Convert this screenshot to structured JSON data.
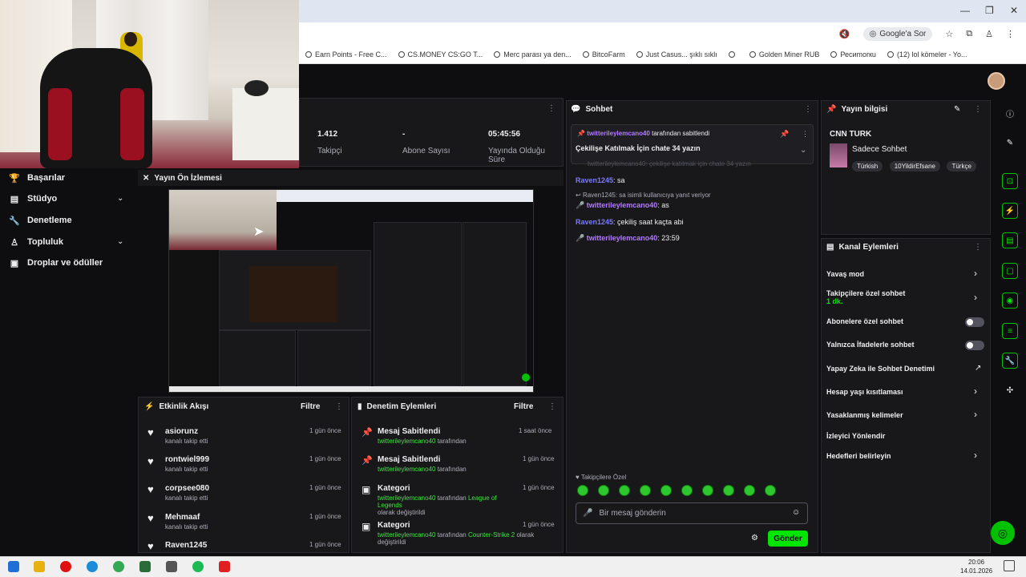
{
  "browser": {
    "google_sor": "Google'a Sor",
    "bookmarks": [
      "Earn Points - Free C...",
      "CS.MONEY CS:GO T...",
      "Merc parası ya den...",
      "BitcoFarm",
      "Just Casus... şıklı sıklı",
      "",
      "Golden Miner RUB",
      "Ресиmоrкu",
      "(12) lol kömeler - Yo..."
    ]
  },
  "stats": {
    "followers_value": "1.412",
    "followers_label": "Takipçi",
    "subs_value": "-",
    "subs_label": "Abone Sayısı",
    "live_value": "05:45:56",
    "live_label": "Yayında Olduğu Süre"
  },
  "nav": {
    "items": [
      {
        "label": "Başarılar"
      },
      {
        "label": "Stüdyo"
      },
      {
        "label": "Denetleme"
      },
      {
        "label": "Topluluk"
      },
      {
        "label": "Droplar ve ödüller"
      }
    ]
  },
  "preview": {
    "title": "Yayın Ön İzlemesi"
  },
  "activity": {
    "title": "Etkinlik Akışı",
    "filter": "Filtre",
    "rows": [
      {
        "name": "asiorunz",
        "sub": "kanalı takip etti",
        "time": "1 gün önce"
      },
      {
        "name": "rontwiel999",
        "sub": "kanalı takip etti",
        "time": "1 gün önce"
      },
      {
        "name": "corpsee080",
        "sub": "kanalı takip etti",
        "time": "1 gün önce"
      },
      {
        "name": "Mehmaaf",
        "sub": "kanalı takip etti",
        "time": "1 gün önce"
      },
      {
        "name": "Raven1245",
        "sub": "",
        "time": "1 gün önce"
      }
    ]
  },
  "modactions": {
    "title": "Denetim Eylemleri",
    "filter": "Filtre",
    "rows": [
      {
        "title": "Mesaj Sabitlendi",
        "user": "twitterileylemcano40",
        "rest": " tarafından",
        "extra": "",
        "time": "1 saat önce"
      },
      {
        "title": "Mesaj Sabitlendi",
        "user": "twitterileylemcano40",
        "rest": " tarafından",
        "extra": "",
        "time": "1 gün önce"
      },
      {
        "title": "Kategori",
        "user": "twitterileylemcano40",
        "rest": " tarafından ",
        "hl": "League of Legends",
        "extra": "olarak değiştirildi",
        "time": "1 gün önce"
      },
      {
        "title": "Kategori",
        "user": "twitterileylemcano40",
        "rest": " tarafından ",
        "hl": "Counter-Strike 2",
        "tail": " olarak",
        "extra": "değiştirildi",
        "time": "1 gün önce"
      }
    ]
  },
  "chat": {
    "title": "Sohbet",
    "pinned_user": "twitterileylemcano40",
    "pinned_by": " tarafından sabitlendi",
    "pinned_text": "Çekilişe Katılmak İçin chate 34 yazın",
    "faded": "twitterileylemcano40: çekilişe katılmak için chate 34 yazın",
    "messages": [
      {
        "user": "Raven1245",
        "text": ": sa",
        "mod": false
      },
      {
        "user": "twitterileylemcano40",
        "text": ": as",
        "mod": true,
        "reply": "Raven1245: sa isimli kullanıcıya yanıt veriyor"
      },
      {
        "user": "Raven1245",
        "text": ": çekiliş saat kaçta abi",
        "mod": false
      },
      {
        "user": "twitterileylemcano40",
        "text": ": 23:59",
        "mod": true
      }
    ],
    "follower_only": "Takipçilere Özel",
    "input_placeholder": "Bir mesaj gönderin",
    "send": "Gönder"
  },
  "info": {
    "title": "Yayın bilgisi",
    "stream_title": "CNN TURK",
    "category": "Sadece Sohbet",
    "tags": [
      "Türkish",
      "10YildirEfsane",
      "Türkçe"
    ]
  },
  "actions": {
    "title": "Kanal Eylemleri",
    "rows": [
      {
        "label": "Yavaş mod",
        "kind": "arrow"
      },
      {
        "label": "Takipçilere özel sohbet",
        "sub": "1 dk.",
        "kind": "arrow"
      },
      {
        "label": "Abonelere özel sohbet",
        "kind": "toggle"
      },
      {
        "label": "Yalnızca İfadelerle sohbet",
        "kind": "toggle"
      },
      {
        "label": "Yapay Zeka ile Sohbet Denetimi",
        "kind": "ext"
      },
      {
        "label": "Hesap yaşı kısıtlaması",
        "kind": "arrow"
      },
      {
        "label": "Yasaklanmış kelimeler",
        "kind": "arrow"
      },
      {
        "label": "İzleyici Yönlendir",
        "kind": "none"
      },
      {
        "label": "Hedefleri belirleyin",
        "kind": "arrow"
      }
    ]
  },
  "taskbar": {
    "time": "20:06",
    "date": "14.01.2026"
  },
  "colors": {
    "accent": "#00e600",
    "bg": "#0e0e10",
    "panel": "#18181b"
  }
}
